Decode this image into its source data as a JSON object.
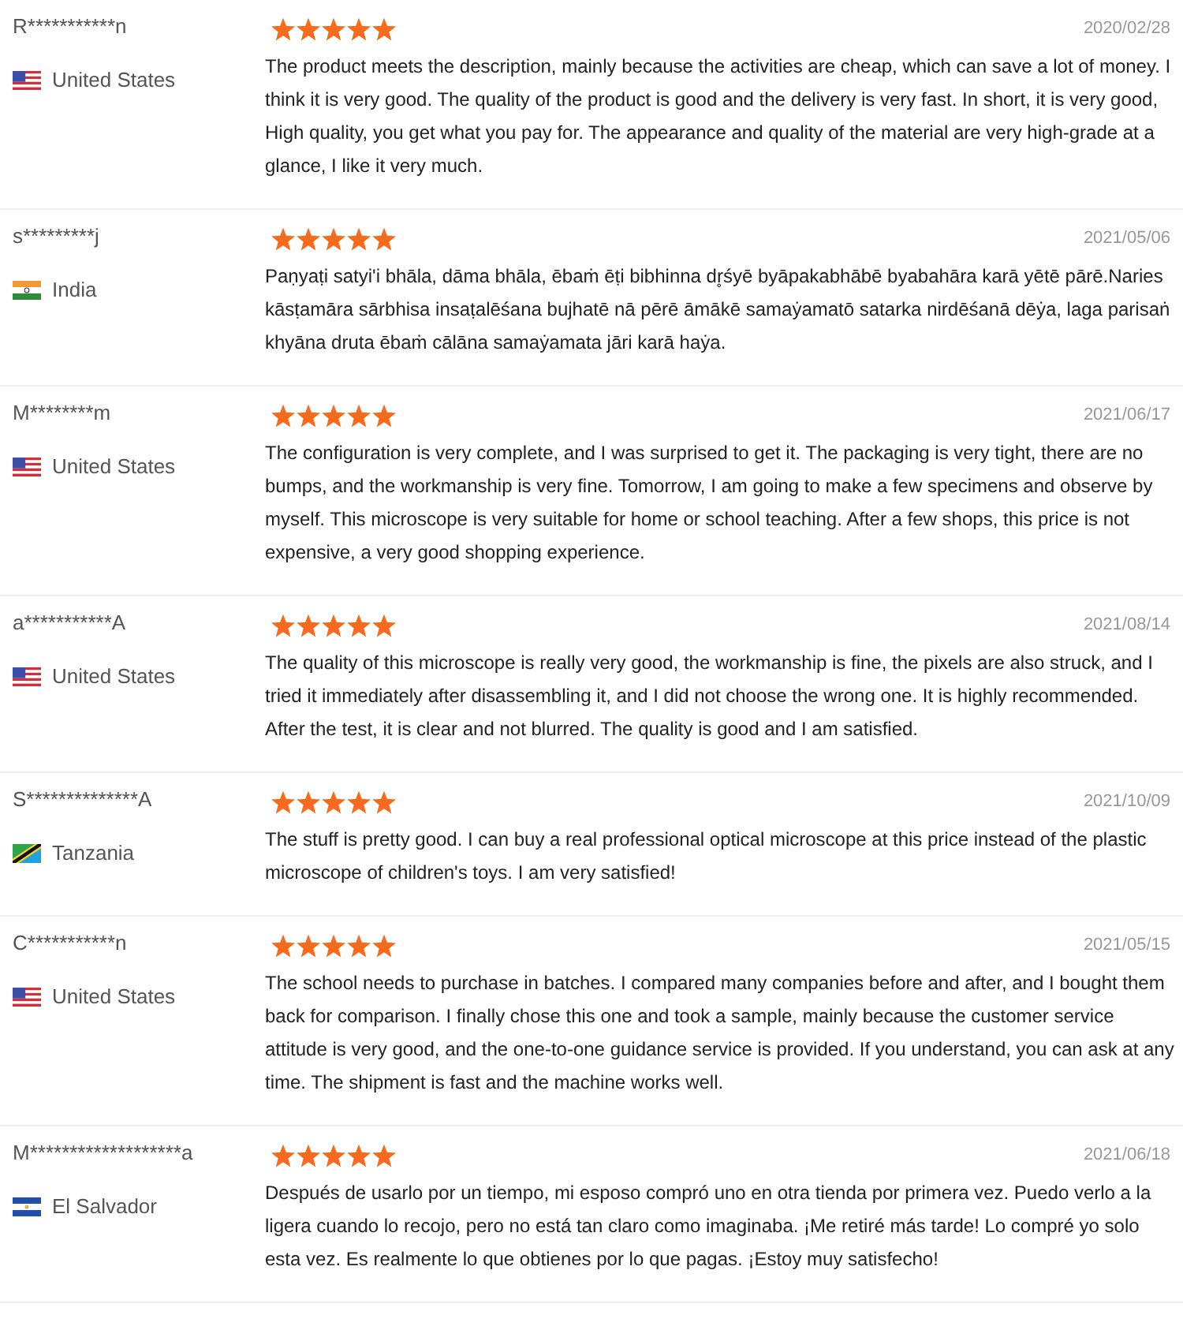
{
  "reviews": [
    {
      "name": "R***********n",
      "country": {
        "name": "United States",
        "kind": "us"
      },
      "stars": 5,
      "date": "2020/02/28",
      "text": "The product meets the description, mainly because the activities are cheap, which can save a lot of money. I think it is very good. The quality of the product is good and the delivery is very fast. In short, it is very good, High quality, you get what you pay for. The appearance and quality of the material are very high-grade at a glance, I like it very much."
    },
    {
      "name": "s*********j",
      "country": {
        "name": "India",
        "kind": "in"
      },
      "stars": 5,
      "date": "2021/05/06",
      "text": "Paṇyaṭi satyi'i bhāla, dāma bhāla, ēbaṁ ēṭi bibhinna dr̥śyē byāpakabhābē byabahāra karā yētē pārē.Naries kāsṭamāra sārbhisa insaṭalēśana bujhatē nā pērē āmākē samaẏamatō satarka nirdēśanā dēẏa, laga parisaṅ khyāna druta ēbaṁ cālāna samaẏamata jāri karā haẏa."
    },
    {
      "name": "M********m",
      "country": {
        "name": "United States",
        "kind": "us"
      },
      "stars": 5,
      "date": "2021/06/17",
      "text": "The configuration is very complete, and I was surprised to get it. The packaging is very tight, there are no bumps, and the workmanship is very fine. Tomorrow, I am going to make a few specimens and observe by myself. This microscope is very suitable for home or school teaching. After a few shops, this price is not expensive, a very good shopping experience."
    },
    {
      "name": "a***********A",
      "country": {
        "name": "United States",
        "kind": "us"
      },
      "stars": 5,
      "date": "2021/08/14",
      "text": "The quality of this microscope is really very good, the workmanship is fine, the pixels are also struck, and I tried it immediately after disassembling it, and I did not choose the wrong one. It is highly recommended. After the test, it is clear and not blurred. The quality is good and I am satisfied."
    },
    {
      "name": "S**************A",
      "country": {
        "name": "Tanzania",
        "kind": "tz"
      },
      "stars": 5,
      "date": "2021/10/09",
      "text": "The stuff is pretty good. I can buy a real professional optical microscope at this price instead of the plastic microscope of children's toys. I am very satisfied!"
    },
    {
      "name": "C***********n",
      "country": {
        "name": "United States",
        "kind": "us"
      },
      "stars": 5,
      "date": "2021/05/15",
      "text": "The school needs to purchase in batches. I compared many companies before and after, and I bought them back for comparison. I finally chose this one and took a sample, mainly because the customer service attitude is very good, and the one-to-one guidance service is provided. If you understand, you can ask at any time. The shipment is fast and the machine works well."
    },
    {
      "name": "M*******************a",
      "country": {
        "name": "El Salvador",
        "kind": "sv"
      },
      "stars": 5,
      "date": "2021/06/18",
      "text": "Después de usarlo por un tiempo, mi esposo compró uno en otra tienda por primera vez. Puedo verlo a la ligera cuando lo recojo, pero no está tan claro como imaginaba. ¡Me retiré más tarde! Lo compré yo solo esta vez. Es realmente lo que obtienes por lo que pagas. ¡Estoy muy satisfecho!"
    }
  ]
}
